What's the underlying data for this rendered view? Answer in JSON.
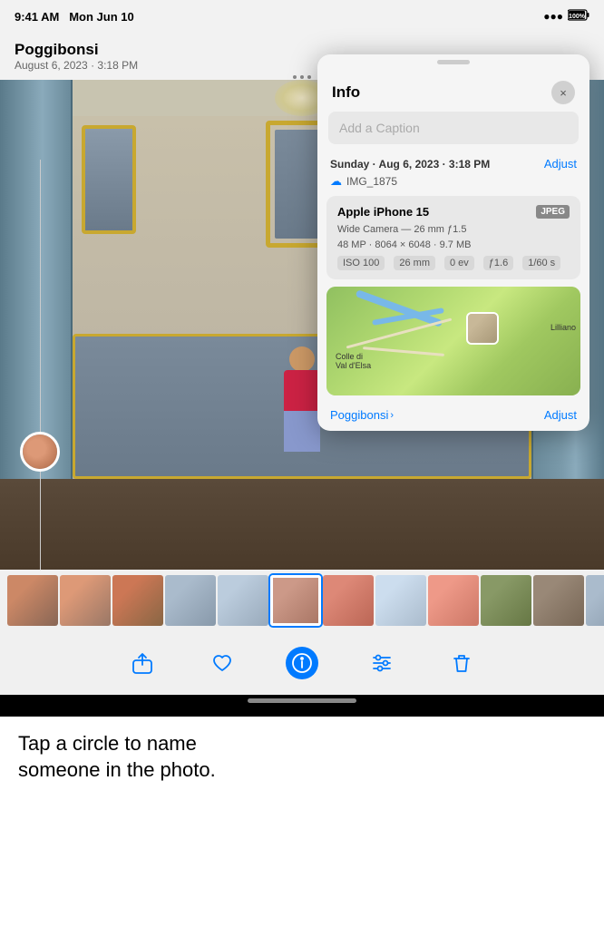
{
  "statusBar": {
    "time": "9:41 AM",
    "date": "Mon Jun 10",
    "wifi": true,
    "battery": "100%"
  },
  "header": {
    "title": "Poggibonsi",
    "subtitle": "August 6, 2023 · 3:18 PM"
  },
  "photo": {
    "alt": "Ornate Italian room with person seated on sofa"
  },
  "infoPanel": {
    "title": "Info",
    "closeLabel": "×",
    "captionPlaceholder": "Add a Caption",
    "date": "Sunday · Aug 6, 2023 · 3:18 PM",
    "adjustLabel": "Adjust",
    "cloudIcon": "☁",
    "filename": "IMG_1875",
    "cameraName": "Apple iPhone 15",
    "cameraFormat": "JPEG",
    "cameraDetails": "Wide Camera — 26 mm ƒ1.5",
    "megapixels": "48 MP · 8064 × 6048 · 9.7 MB",
    "exif": [
      {
        "label": "ISO 100"
      },
      {
        "label": "26 mm"
      },
      {
        "label": "0 ev"
      },
      {
        "label": "ƒ1.6"
      },
      {
        "label": "1/60 s"
      }
    ],
    "locationLabel": "Poggibonsi",
    "adjustLocationLabel": "Adjust",
    "mapLabel1": "Colle di\nVal d'Elsa",
    "mapLabel2": "Lilliano"
  },
  "toolbar": {
    "shareLabel": "Share",
    "likeLabel": "Like",
    "infoLabel": "Info",
    "adjustLabel": "Adjust",
    "deleteLabel": "Delete"
  },
  "bottomText": {
    "instruction": "Tap a circle to name\nsomeone in the photo."
  }
}
